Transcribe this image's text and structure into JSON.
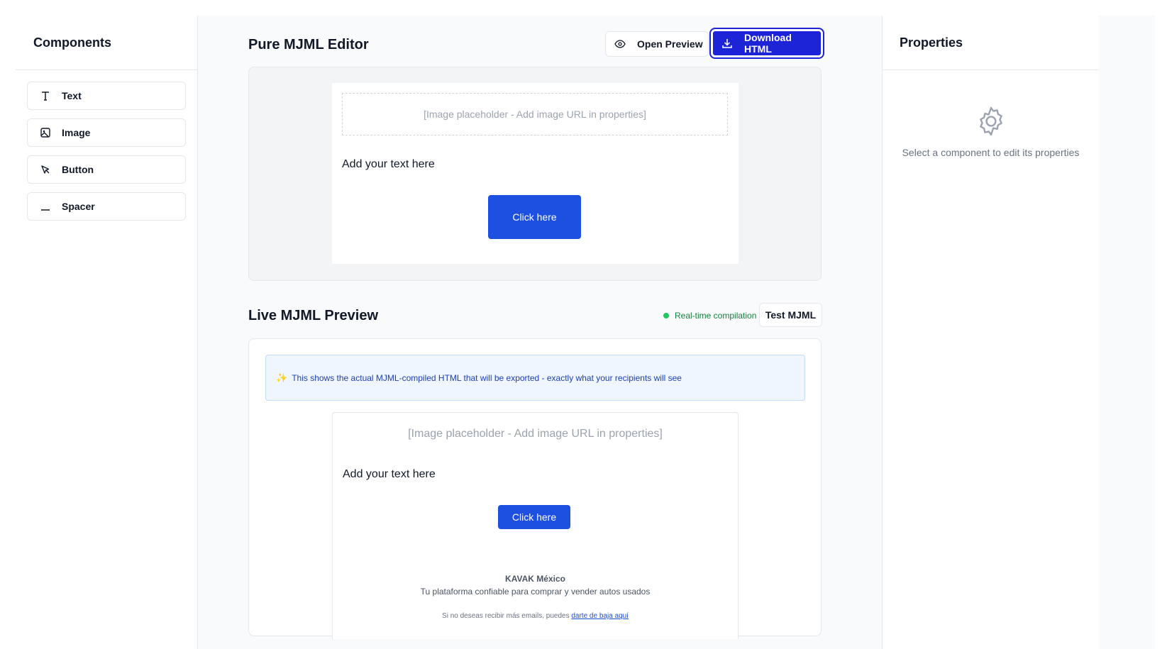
{
  "sidebar": {
    "title": "Components",
    "items": [
      {
        "label": "Text",
        "icon": "text-icon"
      },
      {
        "label": "Image",
        "icon": "image-icon"
      },
      {
        "label": "Button",
        "icon": "cursor-icon"
      },
      {
        "label": "Spacer",
        "icon": "spacer-icon"
      }
    ]
  },
  "editor": {
    "title": "Pure MJML Editor",
    "open_preview_label": "Open Preview",
    "download_label": "Download HTML",
    "canvas": {
      "image_placeholder": "[Image placeholder - Add image URL in properties]",
      "text": "Add your text here",
      "button_label": "Click here"
    }
  },
  "live": {
    "title": "Live MJML Preview",
    "status": "Real-time compilation",
    "test_label": "Test MJML",
    "notice_icon": "✨",
    "notice": "This shows the actual MJML-compiled HTML that will be exported - exactly what your recipients will see",
    "email": {
      "image_placeholder": "[Image placeholder - Add image URL in properties]",
      "text": "Add your text here",
      "button_label": "Click here",
      "brand": "KAVAK México",
      "tagline": "Tu plataforma confiable para comprar y vender autos usados",
      "unsub_prefix": "Si no deseas recibir más emails, puedes",
      "unsub_link": "darte de baja aquí"
    }
  },
  "properties": {
    "title": "Properties",
    "empty_text": "Select a component to edit its properties"
  },
  "colors": {
    "accent": "#1d24d8",
    "button": "#1d4fe0",
    "status_green": "#22c55e"
  }
}
